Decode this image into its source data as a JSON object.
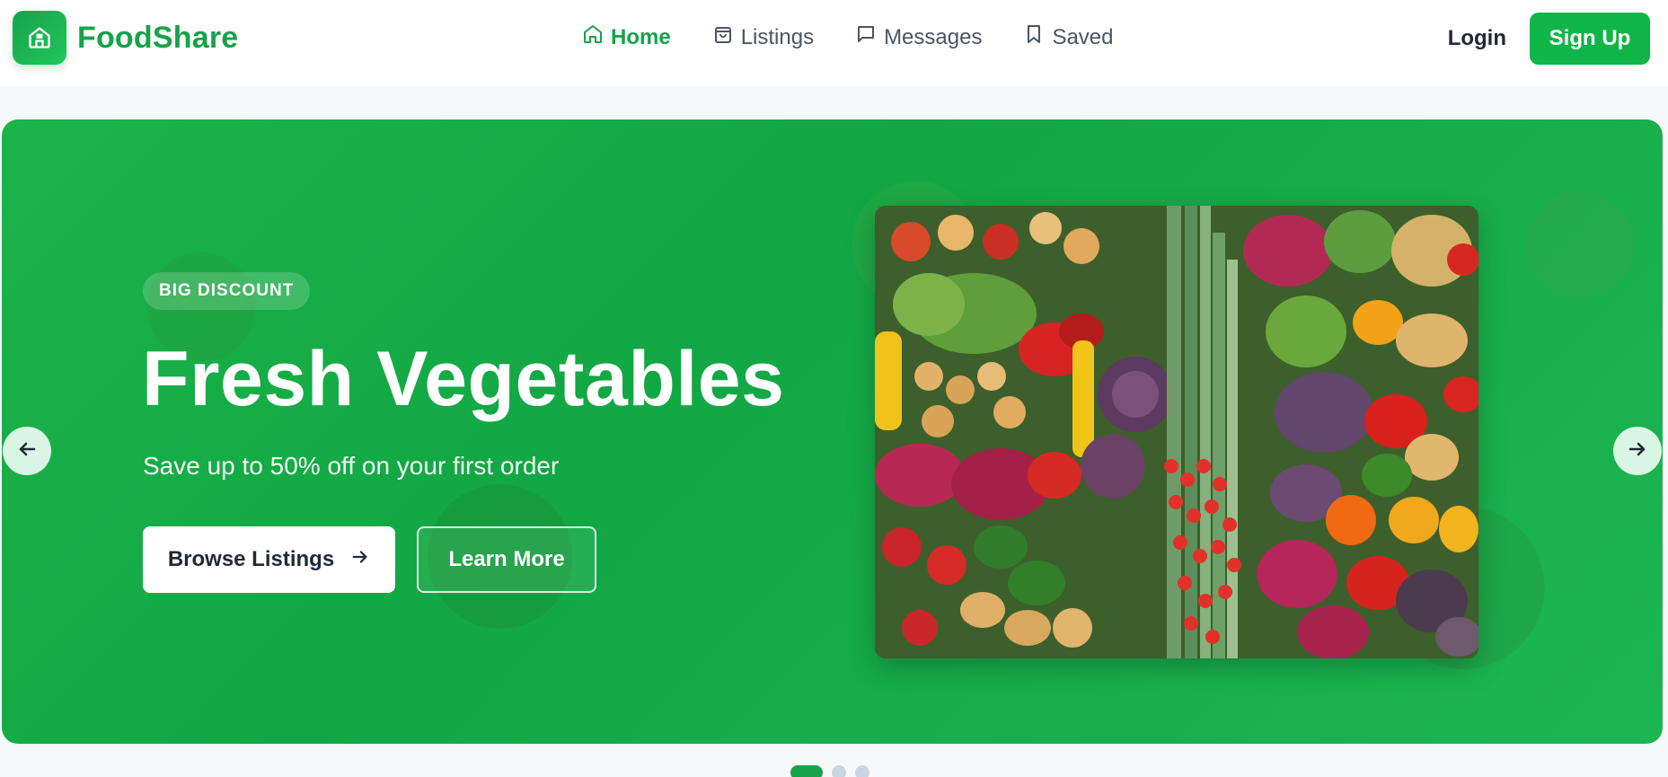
{
  "brand": {
    "name": "FoodShare",
    "icon": "storefront-icon",
    "color": "#16a34a"
  },
  "nav": [
    {
      "label": "Home",
      "icon": "home-icon",
      "active": true
    },
    {
      "label": "Listings",
      "icon": "shopping-bag-icon",
      "active": false
    },
    {
      "label": "Messages",
      "icon": "chat-icon",
      "active": false
    },
    {
      "label": "Saved",
      "icon": "bookmark-icon",
      "active": false
    }
  ],
  "auth": {
    "login_label": "Login",
    "signup_label": "Sign Up"
  },
  "hero": {
    "badge": "BIG DISCOUNT",
    "title": "Fresh Vegetables",
    "subtitle": "Save up to 50% off on your first order",
    "primary_button": "Browse Listings",
    "secondary_button": "Learn More",
    "background_color": "#16a34a"
  },
  "carousel": {
    "slide_count": 3,
    "active_index": 0
  },
  "colors": {
    "accent": "#10b548",
    "text": "#1f2937",
    "muted": "#4b5563"
  }
}
